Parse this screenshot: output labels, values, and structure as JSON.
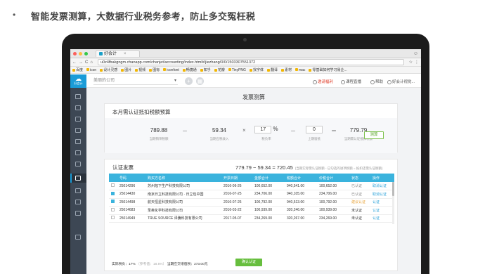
{
  "slide": {
    "bullet": "•",
    "headline": "智能发票测算，大数据行业税务参考，防止多交冤枉税"
  },
  "browser": {
    "tab_title": "好会计",
    "tab_close": "×",
    "address": "u0z4fbakgngm.chanapp.com/chanjet/accounting/index.html#/jiezhang/0/0/1503307551372",
    "bookmarks": [
      "百度",
      "icon",
      "设计灵感",
      "图片",
      "视频",
      "图标",
      "iconfont",
      "畅捷通",
      "知乎",
      "花瓣",
      "TinyPNG",
      "找字体",
      "翻译",
      "素材",
      "mac",
      "零基础如何学习易企..."
    ]
  },
  "app": {
    "logo_text": "好会计",
    "company_placeholder": "美丽的公司",
    "add_symbol": "+",
    "header_items": [
      "邀请福利",
      "课程直播",
      "帮助",
      "好会计视觉..."
    ],
    "page_title": "发票测算"
  },
  "budget": {
    "title": "本月需认证抵扣税额预算",
    "output_tax": "789.88",
    "output_tax_label": "当期销项税额",
    "sales_amount": "59.34",
    "sales_amount_label": "当期应税收入",
    "rate": "17",
    "rate_unit": "%",
    "rate_label": "税负率",
    "credit": "0",
    "credit_label": "上期留抵",
    "result": "779.79",
    "result_label": "当期需认证抵扣税额",
    "ops": [
      "－",
      "×",
      "－",
      "＝"
    ],
    "button": "测算"
  },
  "certify": {
    "title": "认证发票",
    "formula": "779.79 − 59.34 = 720.45",
    "formula_note": "(当期实际需认证税额 - 已勾选的进项税额 = 抵扣还需认证税额)",
    "columns": [
      "号码",
      "购买方名称",
      "开票日期",
      "金额合计",
      "税额合计",
      "价税合计",
      "状态",
      "操作"
    ],
    "rows": [
      {
        "checked": false,
        "no": "25014296",
        "buyer": "苏州旭下生产科技有限公司",
        "date": "2016-06-26",
        "amount": "100,652.00",
        "tax": "940,541.00",
        "total": "100,652.00",
        "status": "已认证",
        "status_kind": "verified",
        "action": "取消认证"
      },
      {
        "checked": true,
        "no": "25014430",
        "buyer": "南京日立科技有限公司 · 日立包中国",
        "date": "2016-07-25",
        "amount": "234,706.00",
        "tax": "940,105.00",
        "total": "234,706.00",
        "status": "已认证",
        "status_kind": "verified",
        "action": "取消认证"
      },
      {
        "checked": true,
        "no": "25014498",
        "buyer": "航天恒星科技有限公司",
        "date": "2016-07-26",
        "amount": "100,792.00",
        "tax": "940,513.00",
        "total": "100,792.00",
        "status": "建议认证",
        "status_kind": "unverified",
        "action": "认证"
      },
      {
        "checked": false,
        "no": "25014683",
        "buyer": "圣奥化学科技有限公司",
        "date": "2016-03-22",
        "amount": "100,939.00",
        "tax": "320,246.00",
        "total": "100,939.00",
        "status": "未认证",
        "status_kind": "plain",
        "action": "认证"
      },
      {
        "checked": false,
        "no": "25014949",
        "buyer": "TRUE SOURCE 泽騰科技有限公司",
        "date": "2017-05-07",
        "amount": "234,269.00",
        "tax": "320,267.00",
        "total": "234,269.00",
        "status": "未认证",
        "status_kind": "plain",
        "action": "认证"
      }
    ],
    "footer_actual_label": "实际税负：",
    "footer_actual_value": "17%",
    "footer_ref": "（参考值：18.5%）",
    "footer_payable_label": "当期应交增值税：",
    "footer_payable_value": "273.00元",
    "button": "确认认证"
  },
  "colors": {
    "accent": "#3ab3dd",
    "sidebar": "#3d4754",
    "confirm": "#67be3e"
  }
}
